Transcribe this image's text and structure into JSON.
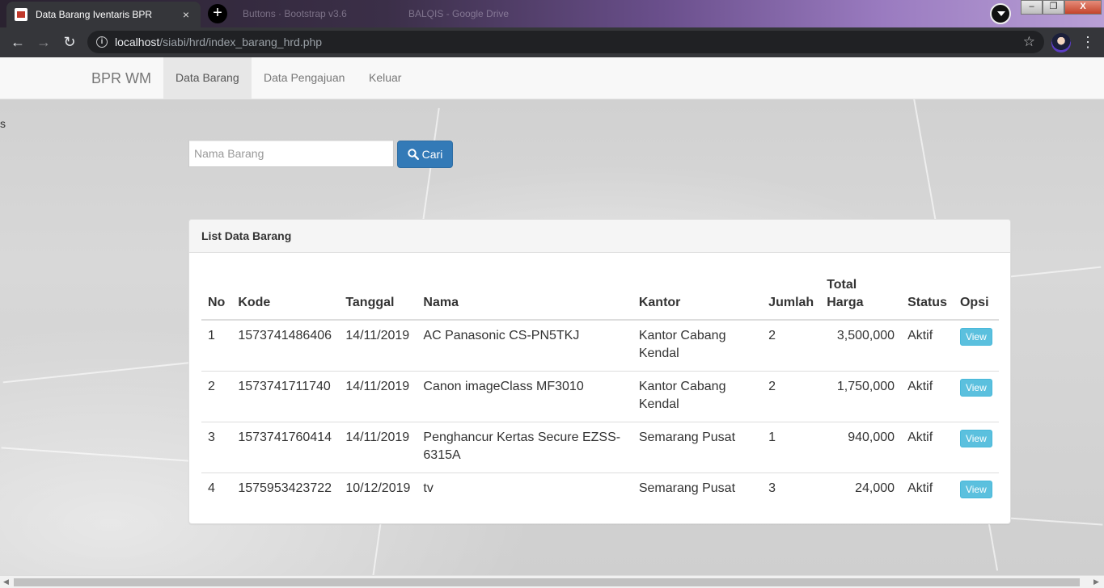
{
  "browser": {
    "active_tab_title": "Data Barang Iventaris BPR",
    "tab_close": "×",
    "new_tab": "+",
    "background_tabs": [
      "Buttons · Bootstrap v3.6",
      "BALQIS - Google Drive"
    ],
    "url_host": "localhost",
    "url_path": "/siabi/hrd/index_barang_hrd.php",
    "window_controls": {
      "minimize": "–",
      "maximize": "❐",
      "close": "X"
    }
  },
  "navbar": {
    "brand": "BPR WM",
    "items": [
      {
        "label": "Data Barang",
        "active": true
      },
      {
        "label": "Data Pengajuan",
        "active": false
      },
      {
        "label": "Keluar",
        "active": false
      }
    ]
  },
  "stray_text": "s",
  "search": {
    "placeholder": "Nama Barang",
    "button_label": "Cari"
  },
  "panel": {
    "title": "List Data Barang",
    "columns": [
      "No",
      "Kode",
      "Tanggal",
      "Nama",
      "Kantor",
      "Jumlah",
      "Total Harga",
      "Status",
      "Opsi"
    ],
    "rows": [
      {
        "no": "1",
        "kode": "1573741486406",
        "tanggal": "14/11/2019",
        "nama": "AC Panasonic CS-PN5TKJ",
        "kantor": "Kantor Cabang Kendal",
        "jumlah": "2",
        "total_harga": "3,500,000",
        "status": "Aktif",
        "opsi": "View"
      },
      {
        "no": "2",
        "kode": "1573741711740",
        "tanggal": "14/11/2019",
        "nama": "Canon imageClass MF3010",
        "kantor": "Kantor Cabang Kendal",
        "jumlah": "2",
        "total_harga": "1,750,000",
        "status": "Aktif",
        "opsi": "View"
      },
      {
        "no": "3",
        "kode": "1573741760414",
        "tanggal": "14/11/2019",
        "nama": "Penghancur Kertas Secure EZSS-6315A",
        "kantor": "Semarang Pusat",
        "jumlah": "1",
        "total_harga": "940,000",
        "status": "Aktif",
        "opsi": "View"
      },
      {
        "no": "4",
        "kode": "1575953423722",
        "tanggal": "10/12/2019",
        "nama": "tv",
        "kantor": "Semarang Pusat",
        "jumlah": "3",
        "total_harga": "24,000",
        "status": "Aktif",
        "opsi": "View"
      }
    ]
  },
  "colors": {
    "primary_button": "#337ab7",
    "info_button": "#5bc0de",
    "navbar_bg": "#f8f8f8",
    "chrome_toolbar": "#35363a"
  }
}
